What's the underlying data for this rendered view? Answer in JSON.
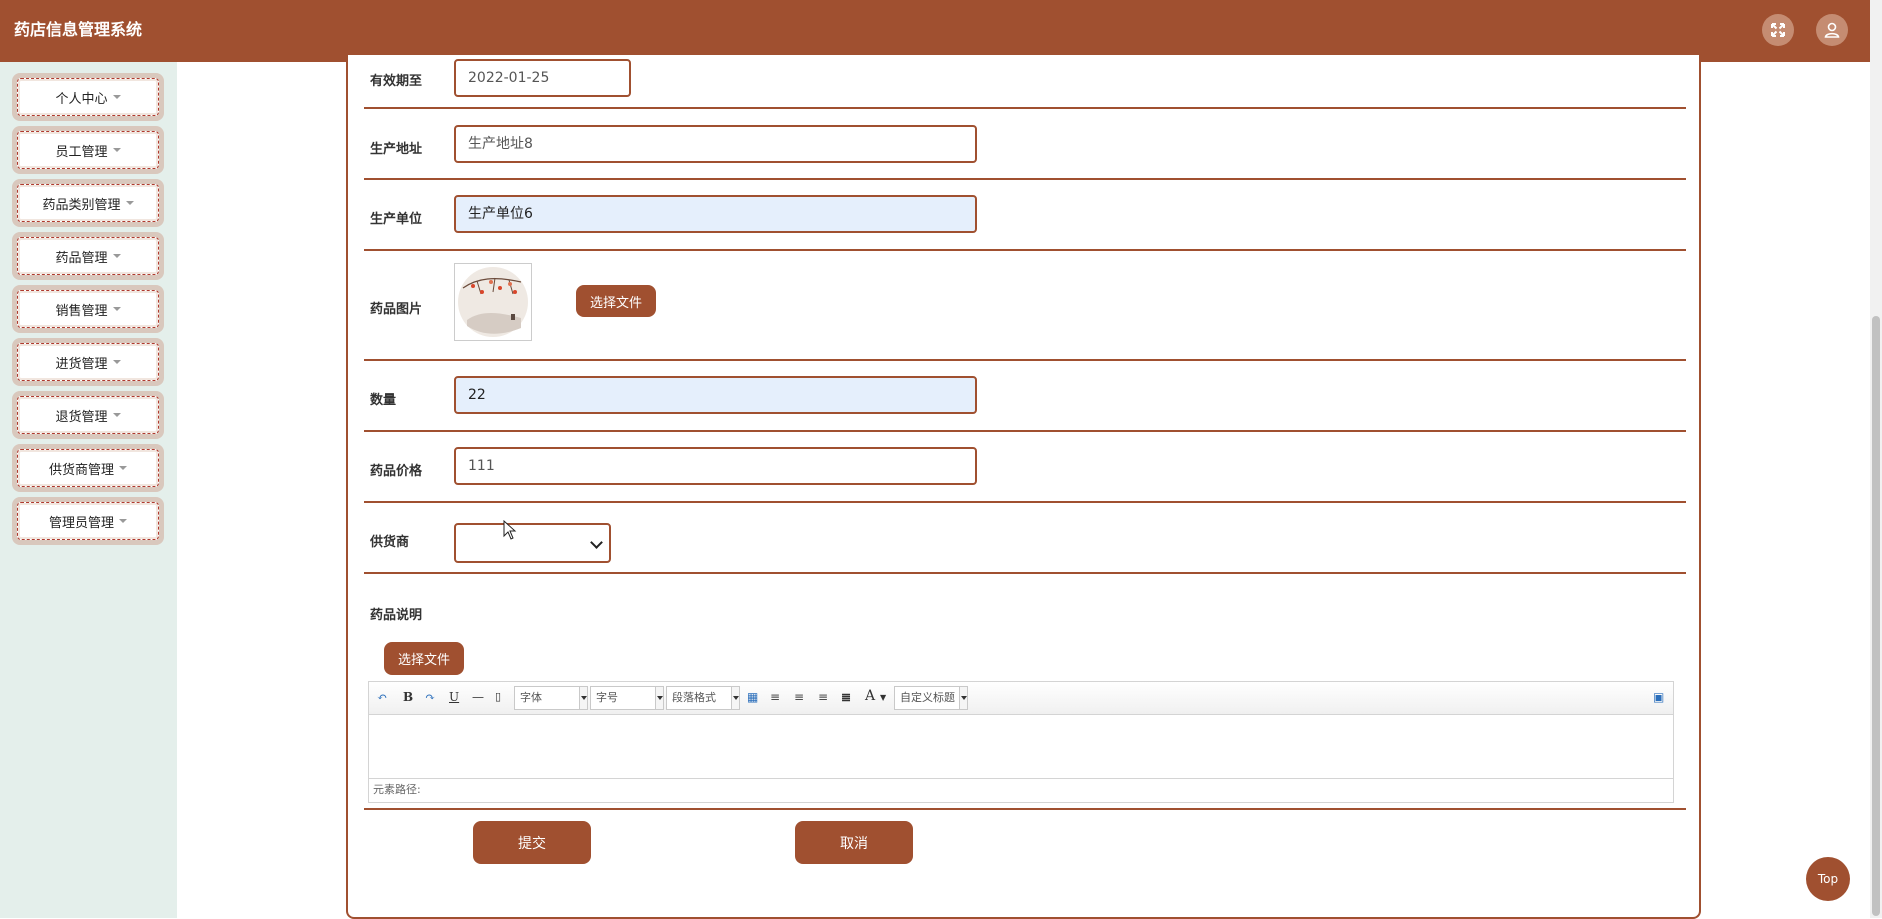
{
  "app": {
    "title": "药店信息管理系统"
  },
  "sidebar": {
    "items": [
      {
        "label": "个人中心"
      },
      {
        "label": "员工管理"
      },
      {
        "label": "药品类别管理"
      },
      {
        "label": "药品管理"
      },
      {
        "label": "销售管理"
      },
      {
        "label": "进货管理"
      },
      {
        "label": "退货管理"
      },
      {
        "label": "供货商管理"
      },
      {
        "label": "管理员管理"
      }
    ]
  },
  "form": {
    "expiry": {
      "label": "有效期至",
      "value": "2022-01-25"
    },
    "address": {
      "label": "生产地址",
      "value": "生产地址8"
    },
    "manufacturer": {
      "label": "生产单位",
      "value": "生产单位6"
    },
    "image": {
      "label": "药品图片",
      "button": "选择文件"
    },
    "quantity": {
      "label": "数量",
      "value": "22"
    },
    "price": {
      "label": "药品价格",
      "value": "111"
    },
    "supplier": {
      "label": "供货商",
      "value": ""
    },
    "description": {
      "label": "药品说明",
      "upload_button": "选择文件",
      "toolbar": {
        "bold": "B",
        "underline": "U",
        "font": "字体",
        "size": "字号",
        "paragraph": "段落格式",
        "color": "A",
        "custom_title": "自定义标题"
      },
      "path_label": "元素路径:"
    },
    "submit": "提交",
    "cancel": "取消"
  },
  "scroll_top": "Top",
  "colors": {
    "brand": "#a05030",
    "sidebar_bg": "#e4efeb",
    "filled_input": "#e5effc"
  }
}
